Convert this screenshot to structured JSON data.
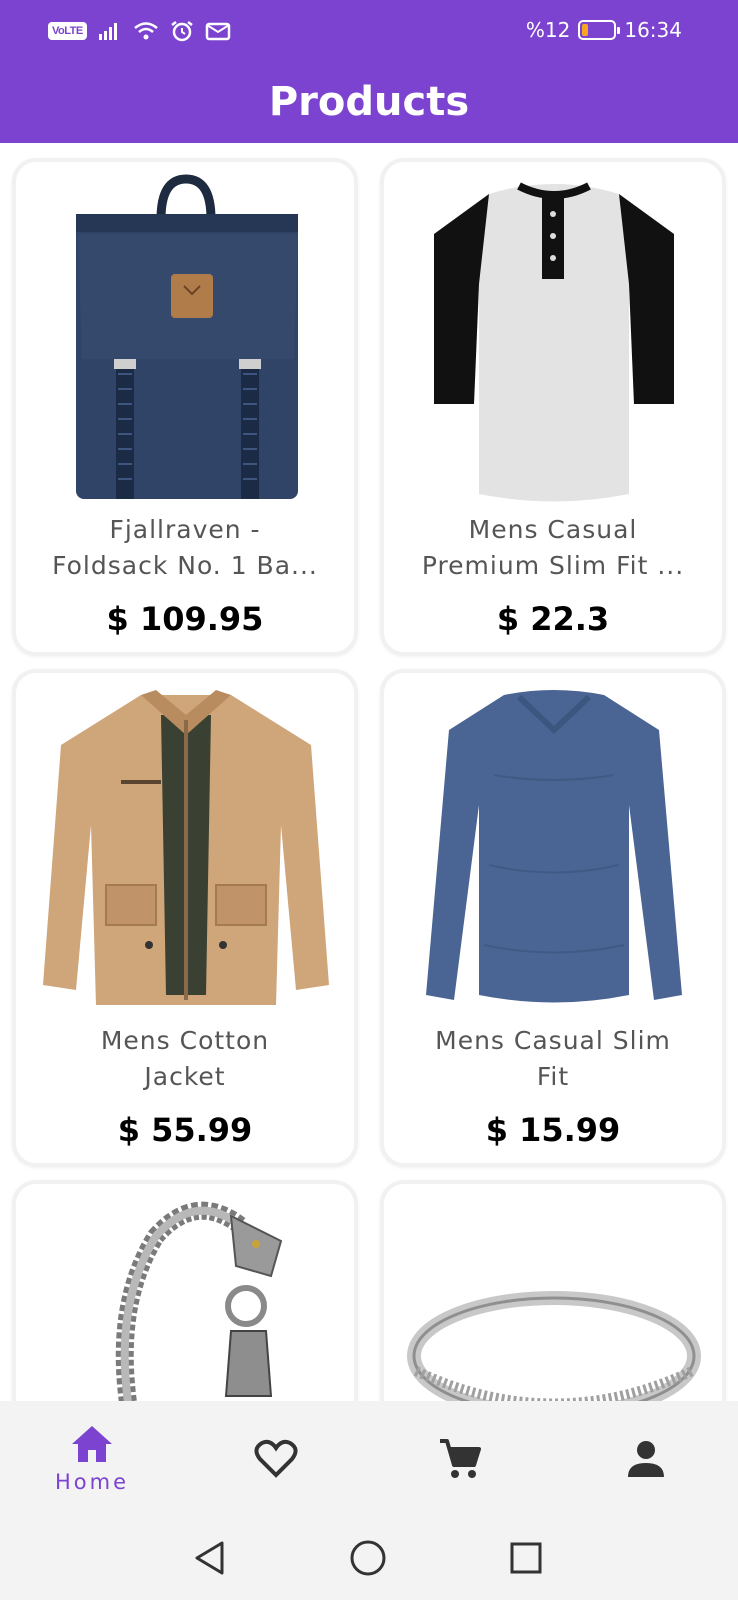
{
  "status_bar": {
    "network_badge": "VoLTE",
    "battery_text": "%12",
    "battery_level": 0.2,
    "time": "16:34",
    "icons": [
      "signal-icon",
      "wifi-icon",
      "alarm-icon",
      "message-icon"
    ]
  },
  "app_bar": {
    "title": "Products",
    "color": "#7B43CF"
  },
  "products": [
    {
      "name": "Fjallraven -\nFoldsack No. 1 Ba...",
      "price": "$ 109.95",
      "image": "backpack"
    },
    {
      "name": "Mens Casual\nPremium Slim Fit ...",
      "price": "$ 22.3",
      "image": "henley-shirt"
    },
    {
      "name": "Mens Cotton\nJacket",
      "price": "$ 55.99",
      "image": "cotton-jacket"
    },
    {
      "name": "Mens Casual Slim\nFit",
      "price": "$ 15.99",
      "image": "long-sleeve-tee"
    },
    {
      "name": "",
      "price": "",
      "image": "dragon-bracelet"
    },
    {
      "name": "",
      "price": "",
      "image": "silver-ring"
    }
  ],
  "bottom_nav": {
    "items": [
      {
        "label": "Home",
        "icon": "home-icon",
        "active": true
      },
      {
        "label": "",
        "icon": "heart-icon",
        "active": false
      },
      {
        "label": "",
        "icon": "cart-icon",
        "active": false
      },
      {
        "label": "",
        "icon": "person-icon",
        "active": false
      }
    ],
    "active_color": "#7B43CF",
    "inactive_color": "#333333"
  },
  "system_nav": {
    "icons": [
      "back-icon",
      "home-circle-icon",
      "recents-icon"
    ]
  }
}
